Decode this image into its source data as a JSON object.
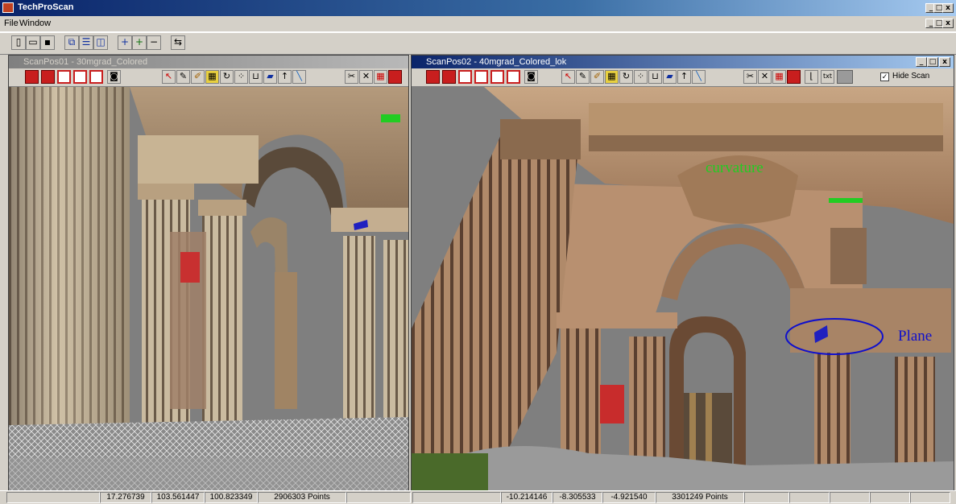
{
  "app": {
    "title": "TechProScan"
  },
  "menu": {
    "file": "File",
    "window": "Window"
  },
  "window_controls": {
    "minimize": "_",
    "restore": "□",
    "close": "x"
  },
  "left_window": {
    "title": "ScanPos01 - 30mgrad_Colored"
  },
  "right_window": {
    "title": "ScanPos02 - 40mgrad_Colored_lok",
    "hide_scan_label": "Hide Scan",
    "hide_scan_checked": true,
    "txt_button": "txt"
  },
  "annotations": {
    "curvature": "curvature",
    "plane": "Plane"
  },
  "status": {
    "left": {
      "x": "17.276739",
      "y": "103.561447",
      "z": "100.823349",
      "points": "2906303 Points"
    },
    "right": {
      "x": "-10.214146",
      "y": "-8.305533",
      "z": "-4.921540",
      "points": "3301249 Points"
    }
  },
  "colors": {
    "title_active": "#0a246a",
    "annotation_green": "#22cc22",
    "annotation_blue": "#1010cc",
    "background": "#808080"
  }
}
